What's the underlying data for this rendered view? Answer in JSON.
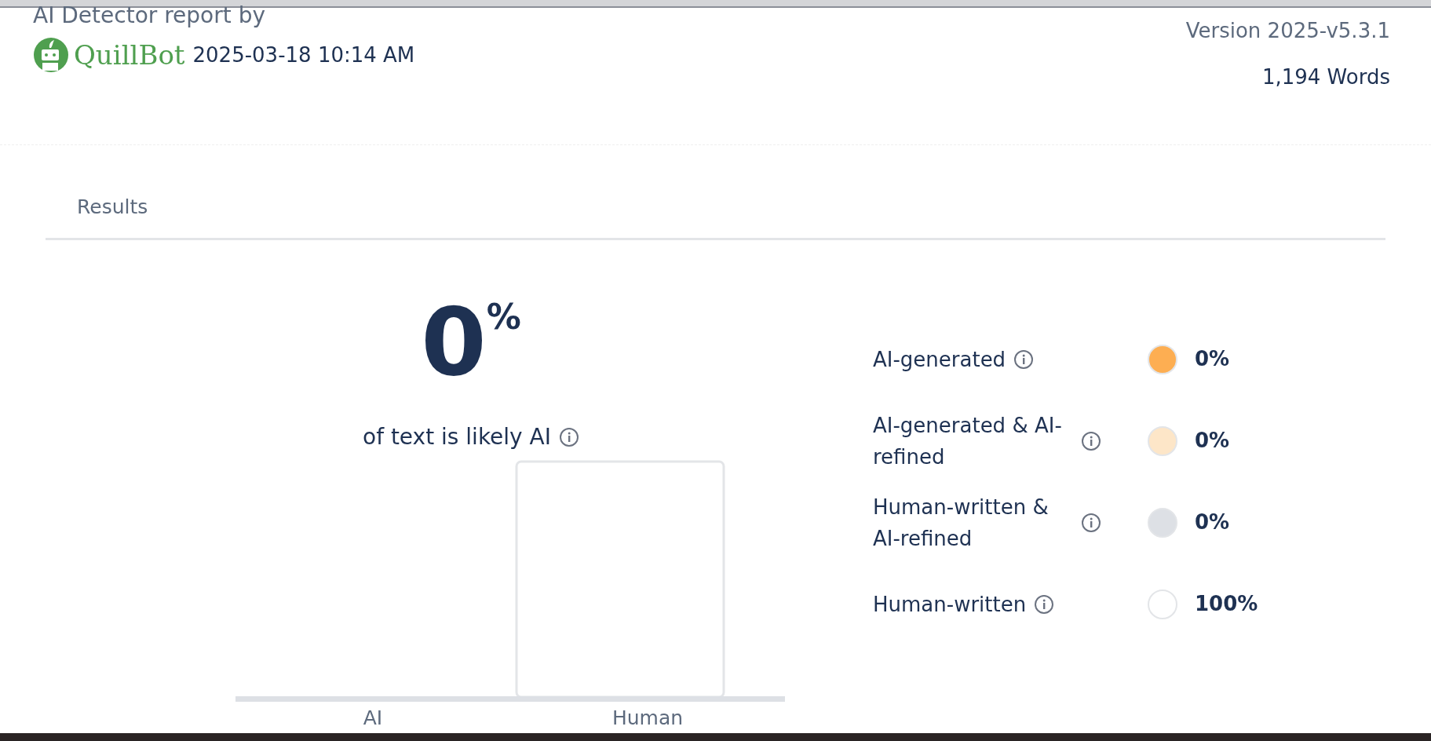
{
  "header": {
    "title": "AI Detector report by",
    "brand": "QuillBot",
    "timestamp": "2025-03-18 10:14 AM",
    "version": "Version 2025-v5.3.1",
    "word_count": "1,194 Words"
  },
  "tabs": [
    {
      "label": "Results",
      "selected": true
    }
  ],
  "score": {
    "value": "0",
    "unit": "%",
    "caption": "of text is likely AI"
  },
  "legend": [
    {
      "label": "AI-generated",
      "color": "#fdae52",
      "value": "0%"
    },
    {
      "label": "AI-generated & AI-refined",
      "color": "#fde6c8",
      "value": "0%"
    },
    {
      "label": "Human-written & AI-refined",
      "color": "#dde0e5",
      "value": "0%"
    },
    {
      "label": "Human-written",
      "color": "#ffffff",
      "value": "100%"
    }
  ],
  "bar_chart": {
    "categories": [
      "AI",
      "Human"
    ]
  }
}
